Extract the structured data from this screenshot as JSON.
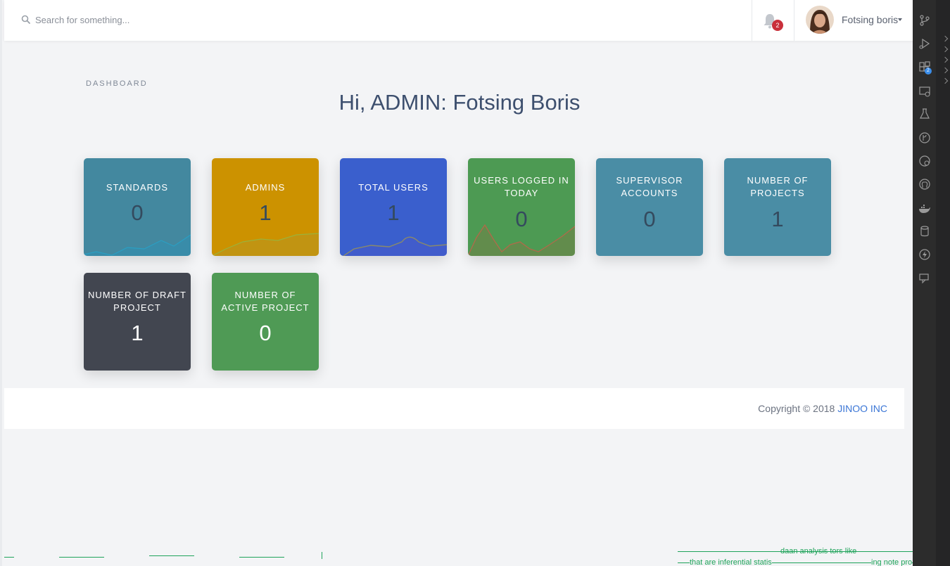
{
  "search": {
    "placeholder": "Search for something..."
  },
  "notifications": {
    "count": "2"
  },
  "user": {
    "name": "Fotsing boris"
  },
  "breadcrumb": "DASHBOARD",
  "page_title": "Hi, ADMIN: Fotsing Boris",
  "cards": [
    {
      "label": "STANDARDS",
      "value": "0",
      "color": "#43889f"
    },
    {
      "label": "ADMINS",
      "value": "1",
      "color": "#cc9200"
    },
    {
      "label": "TOTAL USERS",
      "value": "1",
      "color": "#3a5fcd"
    },
    {
      "label": "USERS LOGGED IN TODAY",
      "value": "0",
      "color": "#4d9a53"
    },
    {
      "label": "SUPERVISOR ACCOUNTS",
      "value": "0",
      "color": "#4a8da5"
    },
    {
      "label": "NUMBER OF PROJECTS",
      "value": "1",
      "color": "#4a8da5"
    },
    {
      "label": "NUMBER OF DRAFT PROJECT",
      "value": "1",
      "color": "#424650"
    },
    {
      "label": "NUMBER OF ACTIVE PROJECT",
      "value": "0",
      "color": "#4f9a55"
    }
  ],
  "footer": {
    "copyright": "Copyright © 2018",
    "company": "JINOO INC"
  },
  "activity_bar": {
    "icons": [
      "source-control-icon",
      "run-debug-icon",
      "extensions-icon",
      "remote-explorer-icon",
      "testing-icon",
      "git-graph-icon",
      "git-history-icon",
      "github-icon",
      "docker-icon",
      "database-icon",
      "lightning-icon",
      "comments-icon"
    ],
    "extensions_badge": "2"
  },
  "bottom_fragments": {
    "line1": "daan analysis tors like",
    "line2": "that are inferential statis",
    "line3": "ing note pro"
  }
}
